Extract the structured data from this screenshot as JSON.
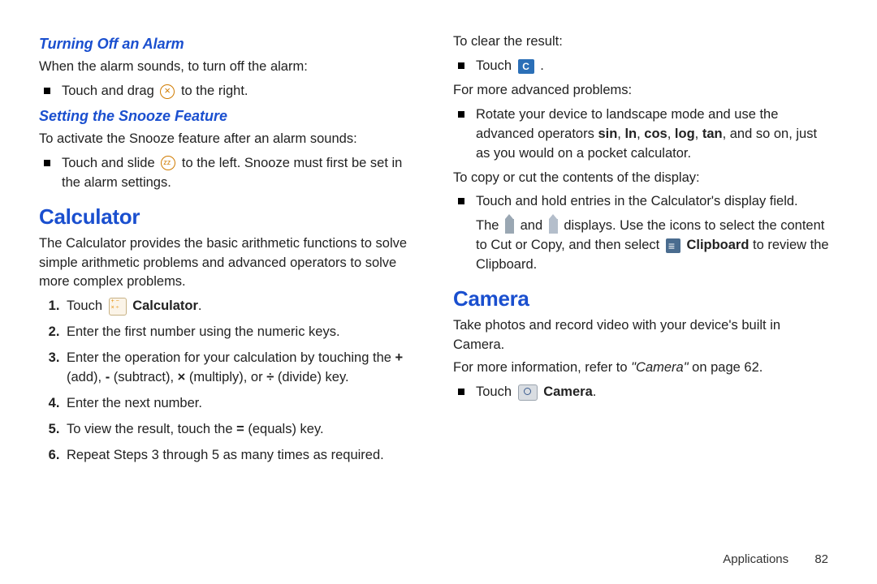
{
  "left": {
    "h_alarm_off": "Turning Off an Alarm",
    "p_alarm_off": "When the alarm sounds, to turn off the alarm:",
    "li_alarm_off": "Touch and drag",
    "li_alarm_off_2": "to the right.",
    "h_snooze": "Setting the Snooze Feature",
    "p_snooze": "To activate the Snooze feature after an alarm sounds:",
    "li_snooze_a": "Touch and slide",
    "li_snooze_b": "to the left. Snooze must first be set in the alarm settings.",
    "h_calc": "Calculator",
    "p_calc": "The Calculator provides the basic arithmetic functions to solve simple arithmetic problems and advanced operators to solve more complex problems.",
    "ol1_a": "Touch",
    "ol1_b": "Calculator",
    "ol2": "Enter the first number using the numeric keys.",
    "ol3_a": "Enter the operation for your calculation by touching the ",
    "ol3_b": "+",
    "ol3_c": " (add), ",
    "ol3_d": "-",
    "ol3_e": " (subtract), ",
    "ol3_f": "×",
    "ol3_g": " (multiply), or ",
    "ol3_h": "÷",
    "ol3_i": " (divide) key.",
    "ol4": "Enter the next number.",
    "ol5_a": "To view the result, touch the ",
    "ol5_b": "=",
    "ol5_c": " (equals) key.",
    "ol6": "Repeat Steps 3 through 5 as many times as required."
  },
  "right": {
    "p_clear": "To clear the result:",
    "li_touch": "Touch",
    "p_adv": "For more advanced problems:",
    "li_adv_a": "Rotate your device to landscape mode and use the advanced operators ",
    "ops": {
      "sin": "sin",
      "ln": "ln",
      "cos": "cos",
      "log": "log",
      "tan": "tan"
    },
    "li_adv_b": ", and so on, just as you would on a pocket calculator.",
    "p_copy": "To copy or cut the contents of the display:",
    "li_copy1": "Touch and hold entries in the Calculator's display field.",
    "li_copy2_a": "The",
    "li_copy2_b": "and",
    "li_copy2_c": "displays. Use the icons to select the content to Cut or Copy, and then select",
    "clipboard_label": "Clipboard",
    "li_copy2_d": "to review the Clipboard.",
    "h_camera": "Camera",
    "p_camera": "Take photos and record video with your device's built in Camera.",
    "p_camref_a": "For more information, refer to ",
    "p_camref_b": "\"Camera\"",
    "p_camref_c": " on page 62.",
    "li_cam_a": "Touch",
    "li_cam_b": "Camera"
  },
  "footer": {
    "section": "Applications",
    "page": "82"
  }
}
